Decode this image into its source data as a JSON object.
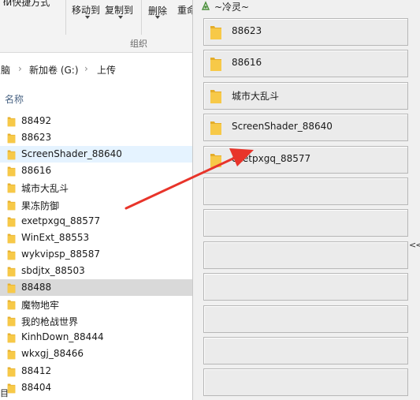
{
  "ribbon": {
    "top_clipped_label": "łи快捷方式",
    "move_to": "移动到",
    "copy_to": "复制到",
    "delete": "删除",
    "rename": "重命",
    "group_label": "组织"
  },
  "address": {
    "crumbs": [
      "脑",
      "新加卷 (G:)",
      "上传"
    ]
  },
  "list": {
    "column_name": "名称",
    "files": [
      {
        "name": "88492"
      },
      {
        "name": "88623"
      },
      {
        "name": "ScreenShader_88640"
      },
      {
        "name": "88616"
      },
      {
        "name": "城市大乱斗"
      },
      {
        "name": "果冻防御"
      },
      {
        "name": "exetpxgq_88577"
      },
      {
        "name": "WinExt_88553"
      },
      {
        "name": "wykvipsp_88587"
      },
      {
        "name": "sbdjtx_88503"
      },
      {
        "name": "88488"
      },
      {
        "name": "魔物地牢"
      },
      {
        "name": "我的枪战世界"
      },
      {
        "name": "KinhDown_88444"
      },
      {
        "name": "wkxgj_88466"
      },
      {
        "name": "88412"
      },
      {
        "name": "88404"
      }
    ],
    "status_text": "目"
  },
  "panel": {
    "title": "~冷灵~",
    "collapse_label": "<<",
    "slots": [
      {
        "label": "88623"
      },
      {
        "label": "88616"
      },
      {
        "label": "城市大乱斗"
      },
      {
        "label": "ScreenShader_88640"
      },
      {
        "label": "exetpxgq_88577"
      },
      {
        "label": ""
      },
      {
        "label": ""
      },
      {
        "label": ""
      },
      {
        "label": ""
      },
      {
        "label": ""
      },
      {
        "label": ""
      },
      {
        "label": ""
      }
    ]
  },
  "colors": {
    "folder_yellow": "#f7c948",
    "folder_dark": "#e4ad2a",
    "arrow_red": "#e8342a"
  }
}
